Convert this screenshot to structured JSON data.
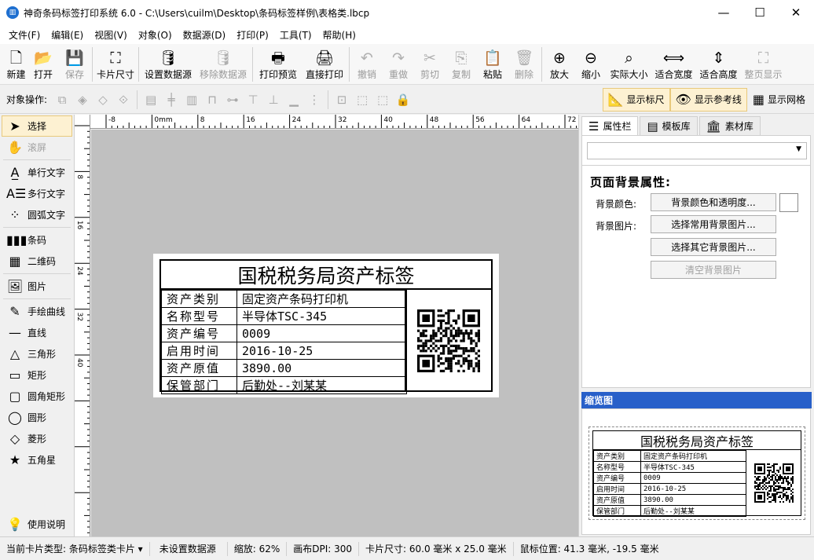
{
  "window": {
    "title": "神奇条码标签打印系统 6.0 - C:\\Users\\cuilm\\Desktop\\条码标签样例\\表格类.lbcp",
    "minimize": "—",
    "maximize": "☐",
    "close": "✕"
  },
  "menu": [
    "文件(F)",
    "编辑(E)",
    "视图(V)",
    "对象(O)",
    "数据源(D)",
    "打印(P)",
    "工具(T)",
    "帮助(H)"
  ],
  "toolbar": [
    {
      "label": "新建",
      "icon": "new-file-icon",
      "glyph": "🗋",
      "enabled": true
    },
    {
      "label": "打开",
      "icon": "open-icon",
      "glyph": "📂",
      "enabled": true
    },
    {
      "label": "保存",
      "icon": "save-icon",
      "glyph": "💾",
      "enabled": false
    },
    {
      "label": "卡片尺寸",
      "icon": "card-size-icon",
      "glyph": "⛶",
      "enabled": true
    },
    {
      "label": "设置数据源",
      "icon": "set-datasource-icon",
      "glyph": "🛢",
      "enabled": true
    },
    {
      "label": "移除数据源",
      "icon": "remove-datasource-icon",
      "glyph": "🛢",
      "enabled": false
    },
    {
      "label": "打印预览",
      "icon": "print-preview-icon",
      "glyph": "🖶",
      "enabled": true
    },
    {
      "label": "直接打印",
      "icon": "print-icon",
      "glyph": "🖨",
      "enabled": true
    },
    {
      "label": "撤销",
      "icon": "undo-icon",
      "glyph": "↶",
      "enabled": false
    },
    {
      "label": "重做",
      "icon": "redo-icon",
      "glyph": "↷",
      "enabled": false
    },
    {
      "label": "剪切",
      "icon": "cut-icon",
      "glyph": "✂",
      "enabled": false
    },
    {
      "label": "复制",
      "icon": "copy-icon",
      "glyph": "⎘",
      "enabled": false
    },
    {
      "label": "粘贴",
      "icon": "paste-icon",
      "glyph": "📋",
      "enabled": true
    },
    {
      "label": "删除",
      "icon": "delete-icon",
      "glyph": "🗑",
      "enabled": false
    },
    {
      "label": "放大",
      "icon": "zoom-in-icon",
      "glyph": "⊕",
      "enabled": true
    },
    {
      "label": "缩小",
      "icon": "zoom-out-icon",
      "glyph": "⊖",
      "enabled": true
    },
    {
      "label": "实际大小",
      "icon": "actual-size-icon",
      "glyph": "⌕",
      "enabled": true
    },
    {
      "label": "适合宽度",
      "icon": "fit-width-icon",
      "glyph": "⟺",
      "enabled": true
    },
    {
      "label": "适合高度",
      "icon": "fit-height-icon",
      "glyph": "⇕",
      "enabled": true
    },
    {
      "label": "整页显示",
      "icon": "full-page-icon",
      "glyph": "⛶",
      "enabled": false
    }
  ],
  "objectops": {
    "label": "对象操作:",
    "icons": [
      "bring-front-icon",
      "bring-forward-icon",
      "send-backward-icon",
      "send-back-icon",
      "align-left-icon",
      "align-center-icon",
      "align-right-icon",
      "align-top-icon",
      "distribute-h-icon",
      "align-top2-icon",
      "align-middle-icon",
      "align-bottom-icon",
      "distribute-v-icon",
      "same-size-icon",
      "group-icon",
      "ungroup-icon",
      "lock-icon"
    ],
    "toggles": [
      {
        "label": "显示标尺",
        "icon": "ruler-icon",
        "glyph": "📐",
        "on": true
      },
      {
        "label": "显示参考线",
        "icon": "guideline-icon",
        "glyph": "👁",
        "on": true
      },
      {
        "label": "显示网格",
        "icon": "grid-icon",
        "glyph": "▦",
        "on": false
      }
    ]
  },
  "tools": [
    {
      "label": "选择",
      "icon": "pointer-icon",
      "glyph": "➤",
      "selected": true,
      "enabled": true
    },
    {
      "label": "滚屏",
      "icon": "hand-icon",
      "glyph": "✋",
      "selected": false,
      "enabled": false
    },
    {
      "label": "单行文字",
      "icon": "single-line-text-icon",
      "glyph": "A̲",
      "selected": false,
      "enabled": true
    },
    {
      "label": "多行文字",
      "icon": "multi-line-text-icon",
      "glyph": "A☰",
      "selected": false,
      "enabled": true
    },
    {
      "label": "圆弧文字",
      "icon": "arc-text-icon",
      "glyph": "⁘",
      "selected": false,
      "enabled": true
    },
    {
      "label": "条码",
      "icon": "barcode-icon",
      "glyph": "▮▮▮",
      "selected": false,
      "enabled": true
    },
    {
      "label": "二维码",
      "icon": "qrcode-icon",
      "glyph": "▦",
      "selected": false,
      "enabled": true
    },
    {
      "label": "图片",
      "icon": "image-icon",
      "glyph": "🖼",
      "selected": false,
      "enabled": true
    },
    {
      "label": "手绘曲线",
      "icon": "freehand-icon",
      "glyph": "✎",
      "selected": false,
      "enabled": true
    },
    {
      "label": "直线",
      "icon": "line-icon",
      "glyph": "—",
      "selected": false,
      "enabled": true
    },
    {
      "label": "三角形",
      "icon": "triangle-icon",
      "glyph": "△",
      "selected": false,
      "enabled": true
    },
    {
      "label": "矩形",
      "icon": "rectangle-icon",
      "glyph": "▭",
      "selected": false,
      "enabled": true
    },
    {
      "label": "圆角矩形",
      "icon": "rounded-rectangle-icon",
      "glyph": "▢",
      "selected": false,
      "enabled": true
    },
    {
      "label": "圆形",
      "icon": "circle-icon",
      "glyph": "◯",
      "selected": false,
      "enabled": true
    },
    {
      "label": "菱形",
      "icon": "diamond-icon",
      "glyph": "◇",
      "selected": false,
      "enabled": true
    },
    {
      "label": "五角星",
      "icon": "star-icon",
      "glyph": "★",
      "selected": false,
      "enabled": true
    }
  ],
  "help": {
    "label": "使用说明",
    "icon": "lightbulb-icon"
  },
  "ruler": {
    "h_labels": [
      "-8",
      "0mm",
      "8",
      "16",
      "24",
      "32",
      "40",
      "48",
      "56",
      "64",
      "72"
    ],
    "v_labels": [
      "8",
      "16",
      "24",
      "32",
      "40"
    ]
  },
  "label": {
    "title": "国税税务局资产标签",
    "rows": [
      {
        "key": "资产类别",
        "value": "固定资产条码打印机"
      },
      {
        "key": "名称型号",
        "value": "半导体TSC-345"
      },
      {
        "key": "资产编号",
        "value": "0009"
      },
      {
        "key": "启用时间",
        "value": "2016-10-25"
      },
      {
        "key": "资产原值",
        "value": "3890.00"
      },
      {
        "key": "保管部门",
        "value": "后勤处--刘某某"
      }
    ]
  },
  "rightpanel": {
    "tabs": [
      {
        "label": "属性栏",
        "icon": "properties-icon",
        "glyph": "☰",
        "active": true
      },
      {
        "label": "模板库",
        "icon": "template-icon",
        "glyph": "▤",
        "active": false
      },
      {
        "label": "素材库",
        "icon": "library-icon",
        "glyph": "🏛",
        "active": false
      }
    ],
    "dropdown_value": "",
    "heading": "页面背景属性:",
    "bg_color_label": "背景颜色:",
    "bg_color_button": "背景颜色和透明度...",
    "bg_image_label": "背景图片:",
    "bg_common_button": "选择常用背景图片...",
    "bg_other_button": "选择其它背景图片...",
    "clear_button": "清空背景图片",
    "bg_color": "#ffffff",
    "preview_title": "缩览图"
  },
  "status": {
    "card_type": "当前卡片类型: 条码标签类卡片",
    "datasource": "未设置数据源",
    "zoom": "缩放: 62%",
    "dpi": "画布DPI: 300",
    "card_size": "卡片尺寸: 60.0 毫米 x 25.0 毫米",
    "mouse": "鼠标位置: 41.3 毫米, -19.5 毫米"
  }
}
